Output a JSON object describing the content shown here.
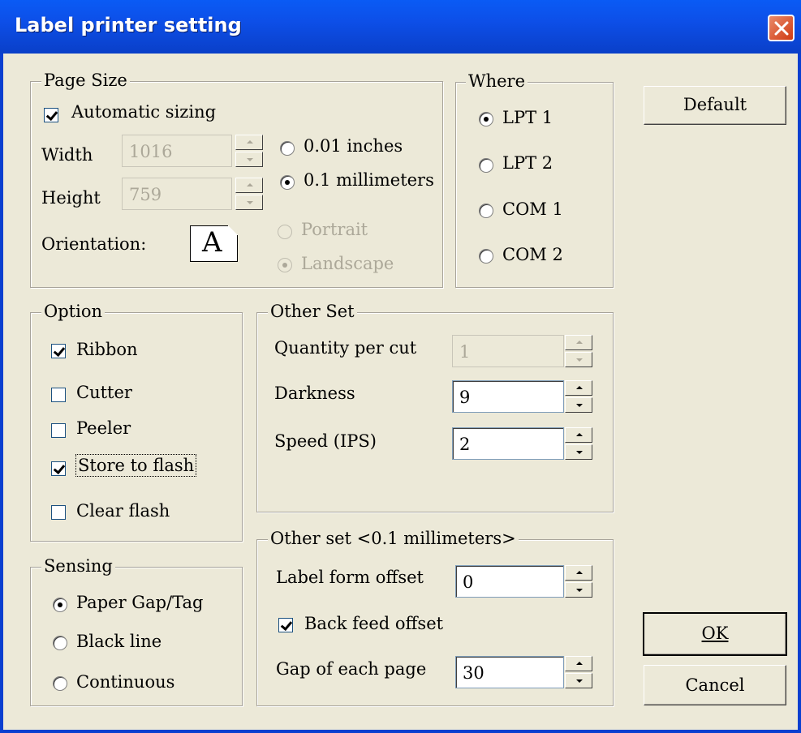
{
  "window": {
    "title": "Label printer setting"
  },
  "page_size": {
    "legend": "Page Size",
    "auto_sizing_label": "Automatic sizing",
    "auto_sizing_checked": true,
    "width_label": "Width",
    "width_value": "1016",
    "height_label": "Height",
    "height_value": "759",
    "units": [
      {
        "label": "0.01 inches",
        "selected": false
      },
      {
        "label": "0.1 millimeters",
        "selected": true
      }
    ],
    "orientation_label": "Orientation:",
    "orientation_icon_letter": "A",
    "orientations": [
      {
        "label": "Portrait",
        "selected": false
      },
      {
        "label": "Landscape",
        "selected": true
      }
    ]
  },
  "where": {
    "legend": "Where",
    "ports": [
      {
        "label": "LPT 1",
        "selected": true
      },
      {
        "label": "LPT 2",
        "selected": false
      },
      {
        "label": "COM 1",
        "selected": false
      },
      {
        "label": "COM 2",
        "selected": false
      }
    ]
  },
  "buttons": {
    "default": "Default",
    "ok": "OK",
    "cancel": "Cancel"
  },
  "option": {
    "legend": "Option",
    "items": [
      {
        "label": "Ribbon",
        "checked": true
      },
      {
        "label": "Cutter",
        "checked": false
      },
      {
        "label": "Peeler",
        "checked": false
      },
      {
        "label": "Store to flash",
        "checked": true
      },
      {
        "label": "Clear flash",
        "checked": false
      }
    ]
  },
  "other_set": {
    "legend": "Other Set",
    "quantity_label": "Quantity per cut",
    "quantity_value": "1",
    "darkness_label": "Darkness",
    "darkness_value": "9",
    "speed_label": "Speed (IPS)",
    "speed_value": "2"
  },
  "sensing": {
    "legend": "Sensing",
    "items": [
      {
        "label": "Paper Gap/Tag",
        "selected": true
      },
      {
        "label": "Black line",
        "selected": false
      },
      {
        "label": "Continuous",
        "selected": false
      }
    ]
  },
  "other_set_mm": {
    "legend": "Other set <0.1 millimeters>",
    "label_form_offset_label": "Label form offset",
    "label_form_offset_value": "0",
    "back_feed_label": "Back feed offset",
    "back_feed_checked": true,
    "gap_label": "Gap of each page",
    "gap_value": "30"
  }
}
